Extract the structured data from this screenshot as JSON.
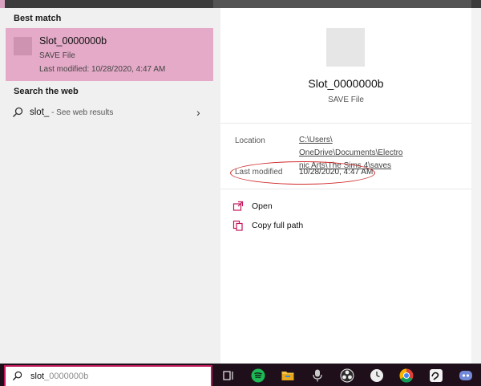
{
  "search_panel": {
    "best_match_heading": "Best match",
    "best_match": {
      "title": "Slot_0000000b",
      "type": "SAVE File",
      "last_modified": "Last modified: 10/28/2020, 4:47 AM"
    },
    "web_heading": "Search the web",
    "web_result": {
      "query": "slot_",
      "suffix": " - See web results"
    }
  },
  "details": {
    "title": "Slot_0000000b",
    "type": "SAVE File",
    "location_label": "Location",
    "location_line1_start": "C:\\Users\\",
    "location_line1_end": "OneDrive\\Documents\\Electro",
    "location_line2": "nic Arts\\The Sims 4\\saves",
    "modified_label": "Last modified",
    "modified_value": "10/28/2020, 4:47 AM",
    "actions": [
      {
        "label": "Open",
        "icon": "open-icon"
      },
      {
        "label": "Copy full path",
        "icon": "copy-icon"
      }
    ]
  },
  "taskbar": {
    "search_typed": "slot",
    "search_ghost": "_0000000b",
    "icons": [
      "task-view-icon",
      "spotify-icon",
      "file-explorer-icon",
      "microphone-icon",
      "obs-icon",
      "clock-app-icon",
      "chrome-icon",
      "app-icon",
      "discord-icon"
    ]
  },
  "colors": {
    "accent": "#c2185b",
    "highlight": "#e4aac8",
    "annotation": "#d02a2a"
  }
}
